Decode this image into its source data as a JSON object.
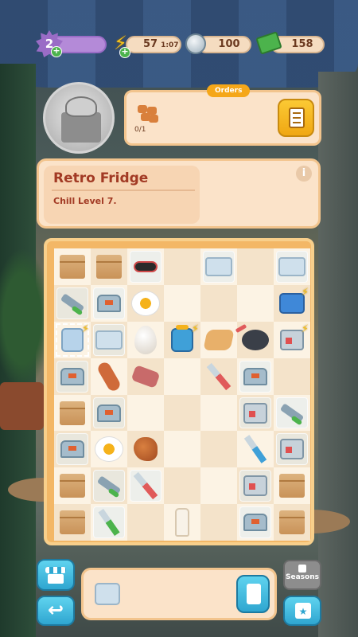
{
  "topbar": {
    "level": "2",
    "energy_value": "57",
    "energy_timer": "1:07",
    "coins": "100",
    "cash": "158"
  },
  "orders": {
    "tab_label": "Orders",
    "item_count": "0/1"
  },
  "info": {
    "title": "Retro Fridge",
    "subtitle": "Chill Level 7.",
    "info_icon": "i"
  },
  "board": {
    "cells": [
      [
        "box",
        "box",
        "waffle",
        "",
        "tray",
        "",
        "tray"
      ],
      [
        "mallet",
        "grater",
        "egg-fried",
        "",
        "",
        "",
        "cooler"
      ],
      [
        "fridge",
        "tray",
        "egg",
        "jar",
        "crepe",
        "pan",
        "toaster"
      ],
      [
        "grater",
        "sausage",
        "bacon",
        "",
        "spatula",
        "grater",
        ""
      ],
      [
        "box",
        "grater",
        "",
        "",
        "",
        "toaster",
        "mallet"
      ],
      [
        "grater",
        "egg-fried",
        "drum",
        "",
        "",
        "fork",
        "toaster"
      ],
      [
        "box",
        "mallet",
        "spatula",
        "",
        "",
        "toaster",
        "box"
      ],
      [
        "box",
        "ladle",
        "",
        "milk",
        "",
        "grater",
        "box"
      ]
    ],
    "bubbles": [
      [
        0,
        0,
        1,
        0,
        1,
        0,
        1
      ],
      [
        1,
        1,
        0,
        0,
        0,
        0,
        0
      ],
      [
        0,
        1,
        0,
        0,
        0,
        0,
        0
      ],
      [
        1,
        0,
        0,
        0,
        0,
        1,
        0
      ],
      [
        0,
        1,
        0,
        0,
        0,
        1,
        1
      ],
      [
        1,
        0,
        0,
        0,
        0,
        0,
        1
      ],
      [
        0,
        1,
        1,
        0,
        0,
        1,
        0
      ],
      [
        0,
        1,
        0,
        0,
        0,
        1,
        0
      ]
    ],
    "bolts": [
      [
        1,
        6
      ],
      [
        2,
        0
      ],
      [
        2,
        3
      ],
      [
        2,
        6
      ]
    ]
  },
  "bottom": {
    "seasons_label": "Seasons"
  }
}
